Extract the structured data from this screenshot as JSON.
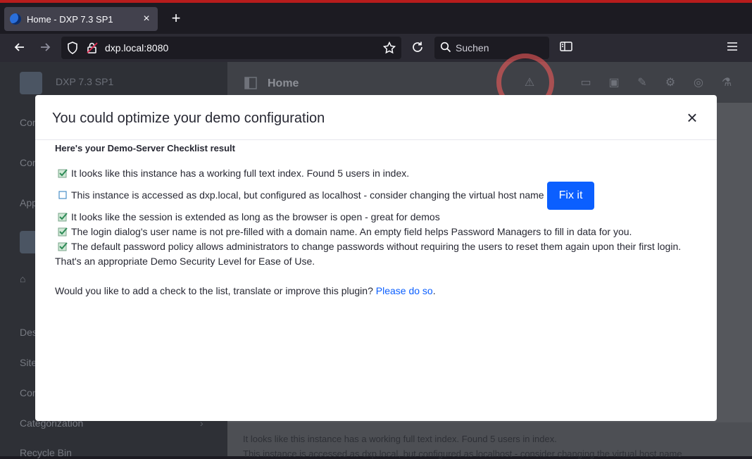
{
  "browser": {
    "tab_title": "Home - DXP 7.3 SP1",
    "tab_close": "×",
    "new_tab": "+",
    "url": "dxp.local:8080",
    "search_placeholder": "Suchen"
  },
  "app": {
    "site_name": "DXP 7.3 SP1",
    "page_title": "Home",
    "sidebar_items": [
      "Con",
      "Con",
      "App",
      "Des",
      "Site",
      "Con",
      "Categorization",
      "Recycle Bin"
    ],
    "background_lines": [
      "It looks like this instance has a working full text index. Found 5 users in index.",
      "This instance is accessed as dxp.local, but configured as localhost - consider changing the virtual host name"
    ]
  },
  "modal": {
    "title": "You could optimize your demo configuration",
    "close_glyph": "×",
    "subheading": "Here's your Demo-Server Checklist result",
    "checks": [
      {
        "text": "It looks like this instance has a working full text index. Found 5 users in index.",
        "checked": true
      },
      {
        "text": "This instance is accessed as dxp.local, but configured as localhost - consider changing the virtual host name",
        "checked": false
      },
      {
        "text": "It looks like the session is extended as long as the browser is open - great for demos",
        "checked": true
      },
      {
        "text": "The login dialog's user name is not pre-filled with a domain name. An empty field helps Password Managers to fill in data for you.",
        "checked": true
      },
      {
        "text": "The default password policy allows administrators to change passwords without requiring the users to reset them again upon their first login.",
        "checked": true
      }
    ],
    "fix_button": "Fix it",
    "summary": "That's an appropriate Demo Security Level for Ease of Use.",
    "footer_question": "Would you like to add a check to the list, translate or improve this plugin? ",
    "footer_link": "Please do so",
    "footer_end": "."
  },
  "colors": {
    "accent": "#0b5fff",
    "check_green": "#2e8b57",
    "alert_ring": "#f05a5a"
  }
}
